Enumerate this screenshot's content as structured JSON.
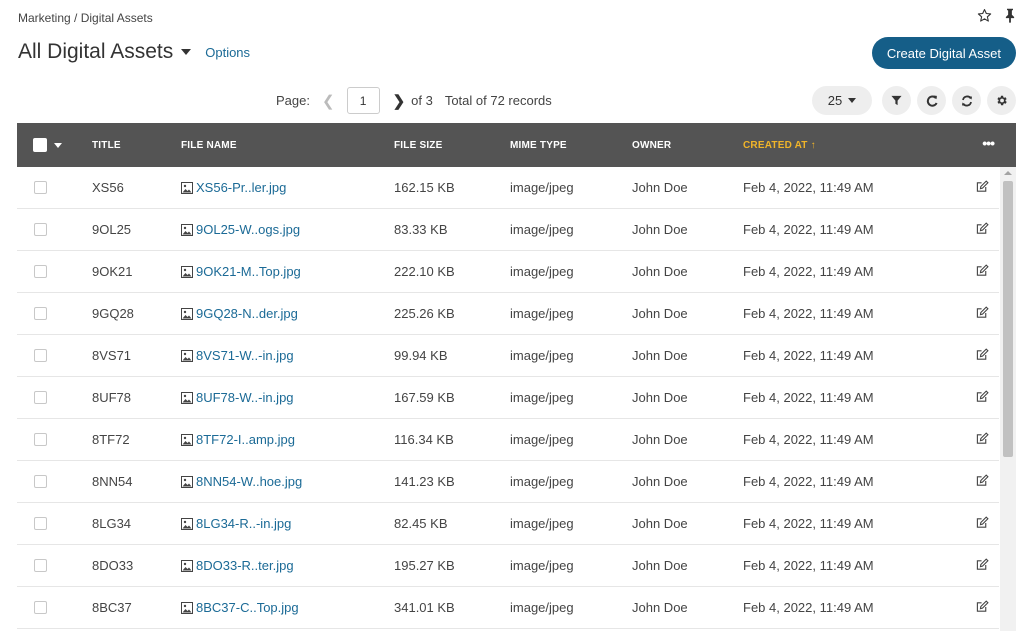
{
  "breadcrumb": "Marketing / Digital Assets",
  "title": "All Digital Assets",
  "options_label": "Options",
  "create_button": "Create Digital Asset",
  "pagination": {
    "page_label": "Page:",
    "current_page": "1",
    "of_label": "of 3",
    "total_label": "Total of 72 records"
  },
  "per_page": "25",
  "columns": {
    "title": "TITLE",
    "file_name": "FILE NAME",
    "file_size": "FILE SIZE",
    "mime_type": "MIME TYPE",
    "owner": "OWNER",
    "created_at": "CREATED AT",
    "more": "•••"
  },
  "sort_indicator": "↑",
  "colors": {
    "accent": "#155e88",
    "link": "#1b6a96",
    "header_bg": "#545454",
    "sorted_column": "#f0b429"
  },
  "icons": [
    "star-icon",
    "pin-icon",
    "filter-icon",
    "reload-icon",
    "sync-icon",
    "gear-icon",
    "image-file-icon",
    "edit-icon"
  ],
  "rows": [
    {
      "title": "XS56",
      "file_name": "XS56-Pr..ler.jpg",
      "file_size": "162.15 KB",
      "mime_type": "image/jpeg",
      "owner": "John Doe",
      "created_at": "Feb 4, 2022, 11:49 AM"
    },
    {
      "title": "9OL25",
      "file_name": "9OL25-W..ogs.jpg",
      "file_size": "83.33 KB",
      "mime_type": "image/jpeg",
      "owner": "John Doe",
      "created_at": "Feb 4, 2022, 11:49 AM"
    },
    {
      "title": "9OK21",
      "file_name": "9OK21-M..Top.jpg",
      "file_size": "222.10 KB",
      "mime_type": "image/jpeg",
      "owner": "John Doe",
      "created_at": "Feb 4, 2022, 11:49 AM"
    },
    {
      "title": "9GQ28",
      "file_name": "9GQ28-N..der.jpg",
      "file_size": "225.26 KB",
      "mime_type": "image/jpeg",
      "owner": "John Doe",
      "created_at": "Feb 4, 2022, 11:49 AM"
    },
    {
      "title": "8VS71",
      "file_name": "8VS71-W..-in.jpg",
      "file_size": "99.94 KB",
      "mime_type": "image/jpeg",
      "owner": "John Doe",
      "created_at": "Feb 4, 2022, 11:49 AM"
    },
    {
      "title": "8UF78",
      "file_name": "8UF78-W..-in.jpg",
      "file_size": "167.59 KB",
      "mime_type": "image/jpeg",
      "owner": "John Doe",
      "created_at": "Feb 4, 2022, 11:49 AM"
    },
    {
      "title": "8TF72",
      "file_name": "8TF72-I..amp.jpg",
      "file_size": "116.34 KB",
      "mime_type": "image/jpeg",
      "owner": "John Doe",
      "created_at": "Feb 4, 2022, 11:49 AM"
    },
    {
      "title": "8NN54",
      "file_name": "8NN54-W..hoe.jpg",
      "file_size": "141.23 KB",
      "mime_type": "image/jpeg",
      "owner": "John Doe",
      "created_at": "Feb 4, 2022, 11:49 AM"
    },
    {
      "title": "8LG34",
      "file_name": "8LG34-R..-in.jpg",
      "file_size": "82.45 KB",
      "mime_type": "image/jpeg",
      "owner": "John Doe",
      "created_at": "Feb 4, 2022, 11:49 AM"
    },
    {
      "title": "8DO33",
      "file_name": "8DO33-R..ter.jpg",
      "file_size": "195.27 KB",
      "mime_type": "image/jpeg",
      "owner": "John Doe",
      "created_at": "Feb 4, 2022, 11:49 AM"
    },
    {
      "title": "8BC37",
      "file_name": "8BC37-C..Top.jpg",
      "file_size": "341.01 KB",
      "mime_type": "image/jpeg",
      "owner": "John Doe",
      "created_at": "Feb 4, 2022, 11:49 AM"
    }
  ]
}
